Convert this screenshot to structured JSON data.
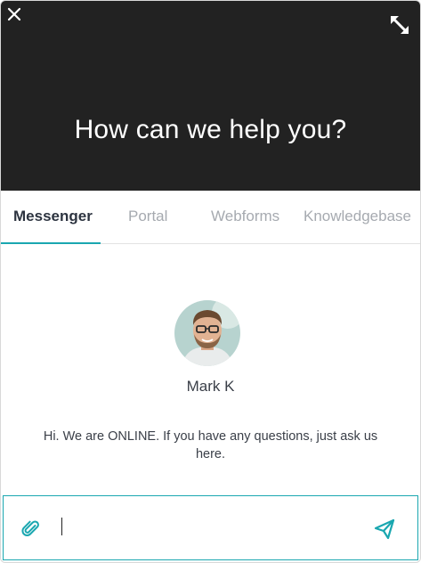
{
  "header": {
    "title": "How can we help you?",
    "close_icon": "close-icon",
    "expand_icon": "expand-icon",
    "background": "#222222"
  },
  "tabs": [
    {
      "label": "Messenger",
      "active": true
    },
    {
      "label": "Portal",
      "active": false
    },
    {
      "label": "Webforms",
      "active": false
    },
    {
      "label": "Knowledgebase",
      "active": false
    }
  ],
  "agent": {
    "name": "Mark K",
    "avatar_icon": "agent-avatar"
  },
  "welcome_message": "Hi. We are ONLINE. If you have any questions, just ask us here.",
  "composer": {
    "value": "",
    "placeholder": "",
    "attach_icon": "paperclip-icon",
    "send_icon": "send-icon"
  },
  "colors": {
    "accent": "#1aa7b0",
    "tab_active": "#2d3440",
    "tab_inactive": "#a6aab0"
  }
}
